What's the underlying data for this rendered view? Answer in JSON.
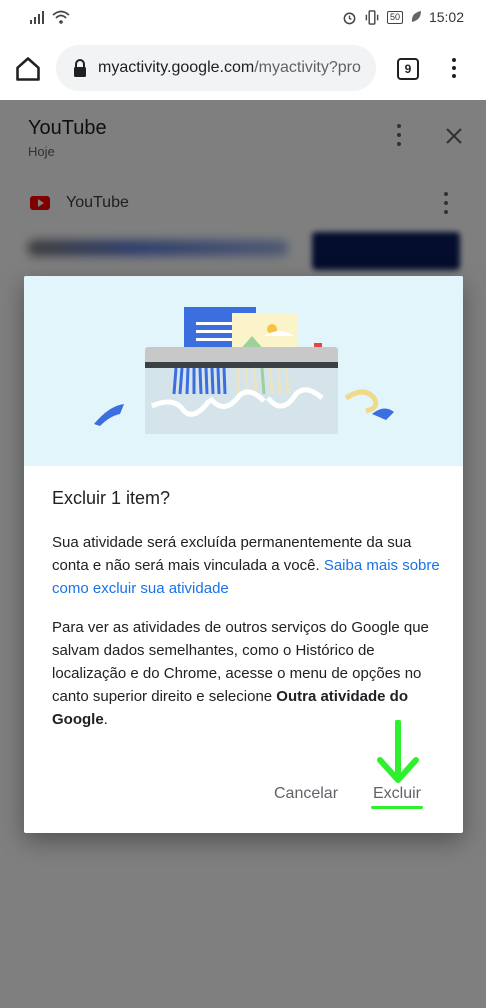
{
  "status_bar": {
    "time": "15:02",
    "battery": "50"
  },
  "browser": {
    "url_host": "myactivity.google.com",
    "url_path": "/myactivity?pro",
    "tab_count": "9"
  },
  "page": {
    "title": "YouTube",
    "subtitle": "Hoje",
    "item_source": "YouTube"
  },
  "dialog": {
    "title": "Excluir 1 item?",
    "p1_text": "Sua atividade será excluída permanentemente da sua conta e não será mais vinculada a você. ",
    "p1_link": "Saiba mais sobre como excluir sua atividade",
    "p2_text": "Para ver as atividades de outros serviços do Google que salvam dados semelhantes, como o Histórico de localização e do Chrome, acesse o menu de opções no canto superior direito e selecione ",
    "p2_bold": "Outra atividade do Google",
    "p2_end": ".",
    "cancel_label": "Cancelar",
    "delete_label": "Excluir"
  },
  "colors": {
    "link": "#1a73e8",
    "highlight": "#2ef02e",
    "illustration_bg": "#e2f5fa",
    "youtube_red": "#ff0000"
  },
  "icons": [
    "signal-icon",
    "wifi-icon",
    "alarm-icon",
    "vibrate-icon",
    "battery-icon",
    "leaf-icon",
    "home-icon",
    "lock-icon",
    "tabs-icon",
    "more-vert-icon",
    "close-icon",
    "youtube-logo-icon",
    "shredder-illustration",
    "down-arrow-annotation"
  ]
}
